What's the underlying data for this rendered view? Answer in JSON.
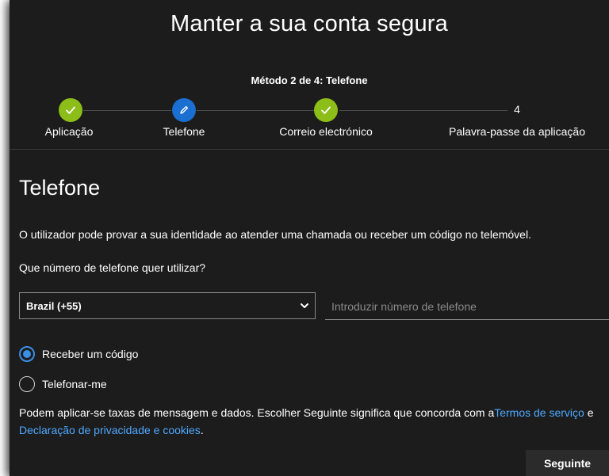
{
  "header": {
    "title": "Manter a sua conta segura",
    "method_progress": "Método 2 de 4: Telefone"
  },
  "steps": [
    {
      "label": "Aplicação",
      "state": "complete",
      "icon": "check-icon"
    },
    {
      "label": "Telefone",
      "state": "current",
      "icon": "pencil-icon"
    },
    {
      "label": "Correio electrónico",
      "state": "complete",
      "icon": "check-icon"
    },
    {
      "label": "Palavra-passe da aplicação",
      "state": "pending",
      "number": "4"
    }
  ],
  "main": {
    "section_title": "Telefone",
    "description": "O utilizador pode provar a sua identidade ao atender uma chamada ou receber um código no telemóvel.",
    "question": "Que número de telefone quer utilizar?",
    "country_select": {
      "value": "Brazil (+55)",
      "icon": "chevron-down-icon"
    },
    "phone_input": {
      "value": "",
      "placeholder": "Introduzir número de telefone"
    },
    "options": [
      {
        "label": "Receber um código",
        "checked": true
      },
      {
        "label": "Telefonar-me",
        "checked": false
      }
    ],
    "terms": {
      "text": "Podem aplicar-se taxas de mensagem e dados. Escolher Seguinte significa que concorda com a",
      "terms_link": "Termos de serviço",
      "connector": " e ",
      "privacy_link": "Declaração de privacidade e cookies",
      "end": "."
    },
    "next_button": "Seguinte"
  },
  "colors": {
    "background": "#1c1c1c",
    "complete": "#8cbd18",
    "current": "#1a6fd1",
    "link": "#4ea8ff",
    "radio_accent": "#3a8ee6"
  }
}
